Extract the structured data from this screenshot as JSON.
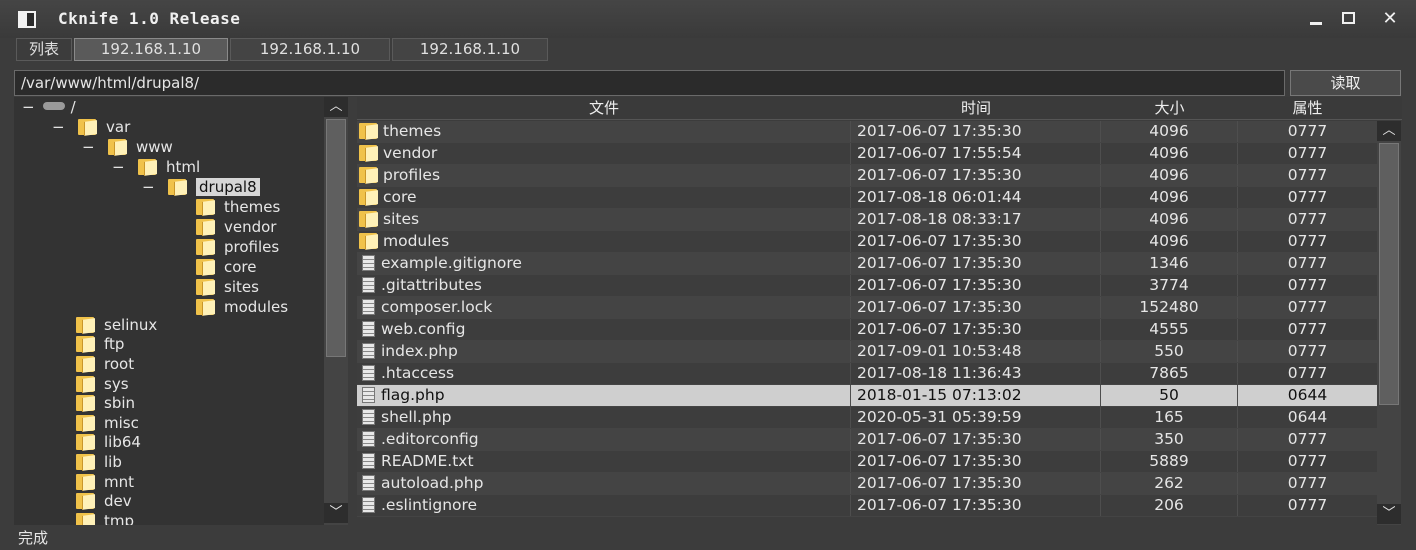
{
  "window": {
    "title": "Cknife 1.0 Release"
  },
  "tabs": [
    {
      "label": "列表"
    },
    {
      "label": "192.168.1.10"
    },
    {
      "label": "192.168.1.10"
    },
    {
      "label": "192.168.1.10"
    }
  ],
  "path": {
    "value": "/var/www/html/drupal8/"
  },
  "read_button": "读取",
  "tree": {
    "root": "/",
    "nodes": [
      "var",
      "www",
      "html",
      "drupal8",
      "themes",
      "vendor",
      "profiles",
      "core",
      "sites",
      "modules",
      "selinux",
      "ftp",
      "root",
      "sys",
      "sbin",
      "misc",
      "lib64",
      "lib",
      "mnt",
      "dev",
      "tmp"
    ]
  },
  "table": {
    "headers": [
      "文件",
      "时间",
      "大小",
      "属性"
    ],
    "rows": [
      {
        "type": "folder",
        "name": "themes",
        "time": "2017-06-07 17:35:30",
        "size": "4096",
        "attr": "0777"
      },
      {
        "type": "folder",
        "name": "vendor",
        "time": "2017-06-07 17:55:54",
        "size": "4096",
        "attr": "0777"
      },
      {
        "type": "folder",
        "name": "profiles",
        "time": "2017-06-07 17:35:30",
        "size": "4096",
        "attr": "0777"
      },
      {
        "type": "folder",
        "name": "core",
        "time": "2017-08-18 06:01:44",
        "size": "4096",
        "attr": "0777"
      },
      {
        "type": "folder",
        "name": "sites",
        "time": "2017-08-18 08:33:17",
        "size": "4096",
        "attr": "0777"
      },
      {
        "type": "folder",
        "name": "modules",
        "time": "2017-06-07 17:35:30",
        "size": "4096",
        "attr": "0777"
      },
      {
        "type": "file",
        "name": "example.gitignore",
        "time": "2017-06-07 17:35:30",
        "size": "1346",
        "attr": "0777"
      },
      {
        "type": "file",
        "name": ".gitattributes",
        "time": "2017-06-07 17:35:30",
        "size": "3774",
        "attr": "0777"
      },
      {
        "type": "file",
        "name": "composer.lock",
        "time": "2017-06-07 17:35:30",
        "size": "152480",
        "attr": "0777"
      },
      {
        "type": "file",
        "name": "web.config",
        "time": "2017-06-07 17:35:30",
        "size": "4555",
        "attr": "0777"
      },
      {
        "type": "file",
        "name": "index.php",
        "time": "2017-09-01 10:53:48",
        "size": "550",
        "attr": "0777"
      },
      {
        "type": "file",
        "name": ".htaccess",
        "time": "2017-08-18 11:36:43",
        "size": "7865",
        "attr": "0777"
      },
      {
        "type": "file",
        "name": "flag.php",
        "time": "2018-01-15 07:13:02",
        "size": "50",
        "attr": "0644",
        "selected": true
      },
      {
        "type": "file",
        "name": "shell.php",
        "time": "2020-05-31 05:39:59",
        "size": "165",
        "attr": "0644"
      },
      {
        "type": "file",
        "name": ".editorconfig",
        "time": "2017-06-07 17:35:30",
        "size": "350",
        "attr": "0777"
      },
      {
        "type": "file",
        "name": "README.txt",
        "time": "2017-06-07 17:35:30",
        "size": "5889",
        "attr": "0777"
      },
      {
        "type": "file",
        "name": "autoload.php",
        "time": "2017-06-07 17:35:30",
        "size": "262",
        "attr": "0777"
      },
      {
        "type": "file",
        "name": ".eslintignore",
        "time": "2017-06-07 17:35:30",
        "size": "206",
        "attr": "0777"
      }
    ]
  },
  "status": "完成"
}
